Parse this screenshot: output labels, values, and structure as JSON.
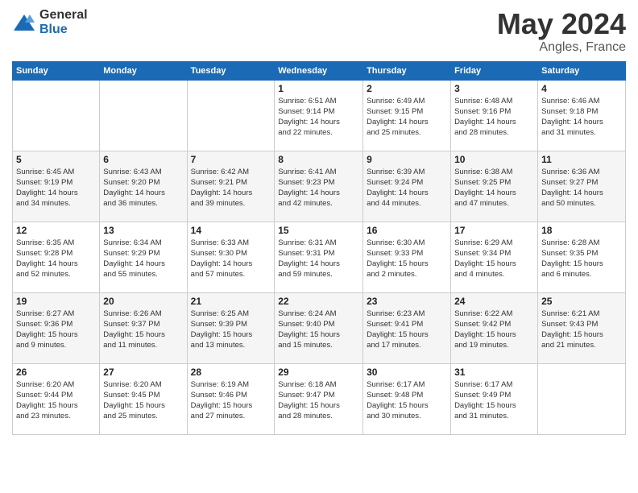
{
  "header": {
    "logo_general": "General",
    "logo_blue": "Blue",
    "title": "May 2024",
    "location": "Angles, France"
  },
  "weekdays": [
    "Sunday",
    "Monday",
    "Tuesday",
    "Wednesday",
    "Thursday",
    "Friday",
    "Saturday"
  ],
  "weeks": [
    [
      {
        "day": "",
        "info": ""
      },
      {
        "day": "",
        "info": ""
      },
      {
        "day": "",
        "info": ""
      },
      {
        "day": "1",
        "info": "Sunrise: 6:51 AM\nSunset: 9:14 PM\nDaylight: 14 hours\nand 22 minutes."
      },
      {
        "day": "2",
        "info": "Sunrise: 6:49 AM\nSunset: 9:15 PM\nDaylight: 14 hours\nand 25 minutes."
      },
      {
        "day": "3",
        "info": "Sunrise: 6:48 AM\nSunset: 9:16 PM\nDaylight: 14 hours\nand 28 minutes."
      },
      {
        "day": "4",
        "info": "Sunrise: 6:46 AM\nSunset: 9:18 PM\nDaylight: 14 hours\nand 31 minutes."
      }
    ],
    [
      {
        "day": "5",
        "info": "Sunrise: 6:45 AM\nSunset: 9:19 PM\nDaylight: 14 hours\nand 34 minutes."
      },
      {
        "day": "6",
        "info": "Sunrise: 6:43 AM\nSunset: 9:20 PM\nDaylight: 14 hours\nand 36 minutes."
      },
      {
        "day": "7",
        "info": "Sunrise: 6:42 AM\nSunset: 9:21 PM\nDaylight: 14 hours\nand 39 minutes."
      },
      {
        "day": "8",
        "info": "Sunrise: 6:41 AM\nSunset: 9:23 PM\nDaylight: 14 hours\nand 42 minutes."
      },
      {
        "day": "9",
        "info": "Sunrise: 6:39 AM\nSunset: 9:24 PM\nDaylight: 14 hours\nand 44 minutes."
      },
      {
        "day": "10",
        "info": "Sunrise: 6:38 AM\nSunset: 9:25 PM\nDaylight: 14 hours\nand 47 minutes."
      },
      {
        "day": "11",
        "info": "Sunrise: 6:36 AM\nSunset: 9:27 PM\nDaylight: 14 hours\nand 50 minutes."
      }
    ],
    [
      {
        "day": "12",
        "info": "Sunrise: 6:35 AM\nSunset: 9:28 PM\nDaylight: 14 hours\nand 52 minutes."
      },
      {
        "day": "13",
        "info": "Sunrise: 6:34 AM\nSunset: 9:29 PM\nDaylight: 14 hours\nand 55 minutes."
      },
      {
        "day": "14",
        "info": "Sunrise: 6:33 AM\nSunset: 9:30 PM\nDaylight: 14 hours\nand 57 minutes."
      },
      {
        "day": "15",
        "info": "Sunrise: 6:31 AM\nSunset: 9:31 PM\nDaylight: 14 hours\nand 59 minutes."
      },
      {
        "day": "16",
        "info": "Sunrise: 6:30 AM\nSunset: 9:33 PM\nDaylight: 15 hours\nand 2 minutes."
      },
      {
        "day": "17",
        "info": "Sunrise: 6:29 AM\nSunset: 9:34 PM\nDaylight: 15 hours\nand 4 minutes."
      },
      {
        "day": "18",
        "info": "Sunrise: 6:28 AM\nSunset: 9:35 PM\nDaylight: 15 hours\nand 6 minutes."
      }
    ],
    [
      {
        "day": "19",
        "info": "Sunrise: 6:27 AM\nSunset: 9:36 PM\nDaylight: 15 hours\nand 9 minutes."
      },
      {
        "day": "20",
        "info": "Sunrise: 6:26 AM\nSunset: 9:37 PM\nDaylight: 15 hours\nand 11 minutes."
      },
      {
        "day": "21",
        "info": "Sunrise: 6:25 AM\nSunset: 9:39 PM\nDaylight: 15 hours\nand 13 minutes."
      },
      {
        "day": "22",
        "info": "Sunrise: 6:24 AM\nSunset: 9:40 PM\nDaylight: 15 hours\nand 15 minutes."
      },
      {
        "day": "23",
        "info": "Sunrise: 6:23 AM\nSunset: 9:41 PM\nDaylight: 15 hours\nand 17 minutes."
      },
      {
        "day": "24",
        "info": "Sunrise: 6:22 AM\nSunset: 9:42 PM\nDaylight: 15 hours\nand 19 minutes."
      },
      {
        "day": "25",
        "info": "Sunrise: 6:21 AM\nSunset: 9:43 PM\nDaylight: 15 hours\nand 21 minutes."
      }
    ],
    [
      {
        "day": "26",
        "info": "Sunrise: 6:20 AM\nSunset: 9:44 PM\nDaylight: 15 hours\nand 23 minutes."
      },
      {
        "day": "27",
        "info": "Sunrise: 6:20 AM\nSunset: 9:45 PM\nDaylight: 15 hours\nand 25 minutes."
      },
      {
        "day": "28",
        "info": "Sunrise: 6:19 AM\nSunset: 9:46 PM\nDaylight: 15 hours\nand 27 minutes."
      },
      {
        "day": "29",
        "info": "Sunrise: 6:18 AM\nSunset: 9:47 PM\nDaylight: 15 hours\nand 28 minutes."
      },
      {
        "day": "30",
        "info": "Sunrise: 6:17 AM\nSunset: 9:48 PM\nDaylight: 15 hours\nand 30 minutes."
      },
      {
        "day": "31",
        "info": "Sunrise: 6:17 AM\nSunset: 9:49 PM\nDaylight: 15 hours\nand 31 minutes."
      },
      {
        "day": "",
        "info": ""
      }
    ]
  ]
}
